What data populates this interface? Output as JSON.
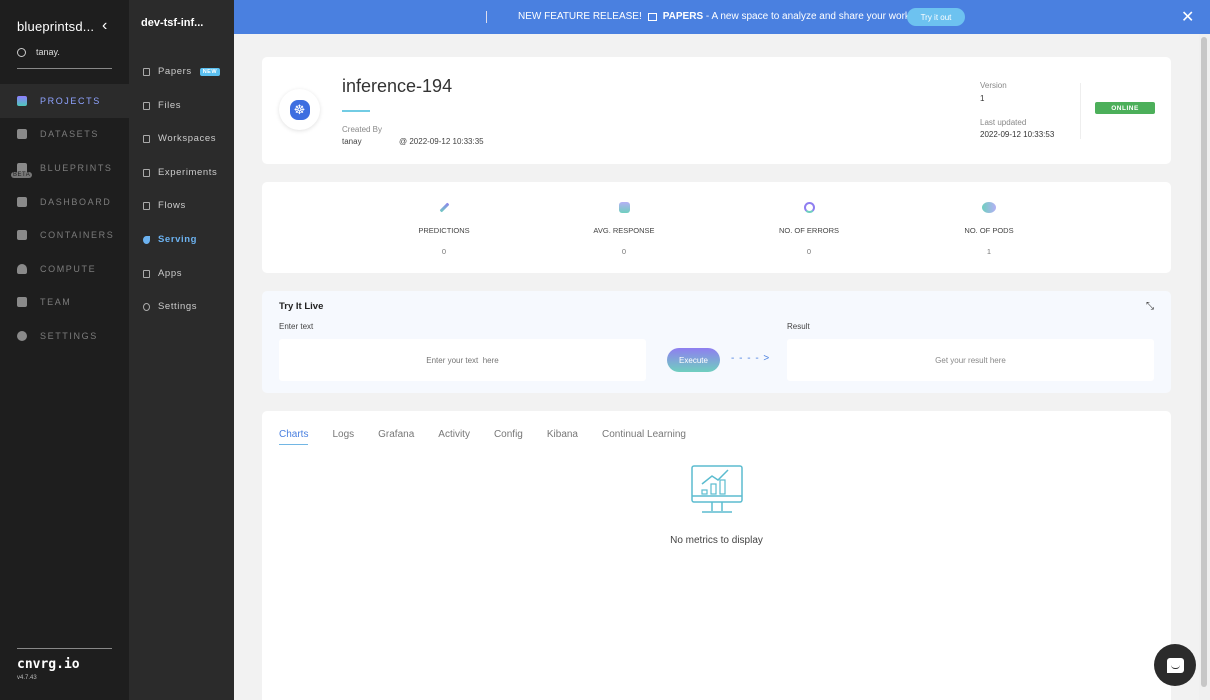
{
  "sidebar": {
    "org_name": "blueprintsd...",
    "user": "tanay.",
    "items": [
      {
        "label": "PROJECTS",
        "icon": "projects-icon",
        "active": true
      },
      {
        "label": "DATASETS",
        "icon": "datasets-icon"
      },
      {
        "label": "BLUEPRINTS",
        "icon": "blueprints-icon",
        "badge": "BETA"
      },
      {
        "label": "DASHBOARD",
        "icon": "dashboard-icon"
      },
      {
        "label": "CONTAINERS",
        "icon": "containers-icon"
      },
      {
        "label": "COMPUTE",
        "icon": "cloud-icon"
      },
      {
        "label": "TEAM",
        "icon": "team-icon"
      },
      {
        "label": "SETTINGS",
        "icon": "gears-icon"
      }
    ],
    "brand": "cnvrg.io",
    "version": "v4.7.43"
  },
  "subnav": {
    "project": "dev-tsf-inf...",
    "items": [
      {
        "label": "Papers",
        "icon": "papers-icon",
        "badge": "NEW"
      },
      {
        "label": "Files",
        "icon": "file-icon"
      },
      {
        "label": "Workspaces",
        "icon": "workspace-icon"
      },
      {
        "label": "Experiments",
        "icon": "flask-icon"
      },
      {
        "label": "Flows",
        "icon": "flows-icon"
      },
      {
        "label": "Serving",
        "icon": "serving-icon",
        "active": true
      },
      {
        "label": "Apps",
        "icon": "apps-icon"
      },
      {
        "label": "Settings",
        "icon": "gear-icon"
      }
    ]
  },
  "banner": {
    "prefix": "NEW FEATURE RELEASE!",
    "feature": "PAPERS",
    "text": " - A new space to analyze and share your work",
    "button": "Try it out",
    "close": "✕"
  },
  "endpoint": {
    "title": "inference-194",
    "created_by_label": "Created By",
    "created_by": "tanay",
    "created_at": "@ 2022-09-12 10:33:35",
    "version_label": "Version",
    "version": "1",
    "updated_label": "Last updated",
    "updated_at": "2022-09-12 10:33:53",
    "status": "ONLINE",
    "status_color": "#4caf5a"
  },
  "stats": [
    {
      "label": "PREDICTIONS",
      "value": "0",
      "icon": "wand-icon"
    },
    {
      "label": "AVG. RESPONSE",
      "value": "0",
      "icon": "clock-icon"
    },
    {
      "label": "NO. OF ERRORS",
      "value": "0",
      "icon": "error-icon"
    },
    {
      "label": "NO. OF PODS",
      "value": "1",
      "icon": "pods-icon"
    }
  ],
  "try_live": {
    "title": "Try It Live",
    "input_label": "Enter text",
    "input_placeholder": "Enter your text  here",
    "execute": "Execute",
    "arrow": "- - - - >",
    "result_label": "Result",
    "result_placeholder": "Get your result here"
  },
  "tabs": [
    "Charts",
    "Logs",
    "Grafana",
    "Activity",
    "Config",
    "Kibana",
    "Continual Learning"
  ],
  "active_tab": "Charts",
  "empty_message": "No metrics to display",
  "accent_color": "#4a80e0"
}
